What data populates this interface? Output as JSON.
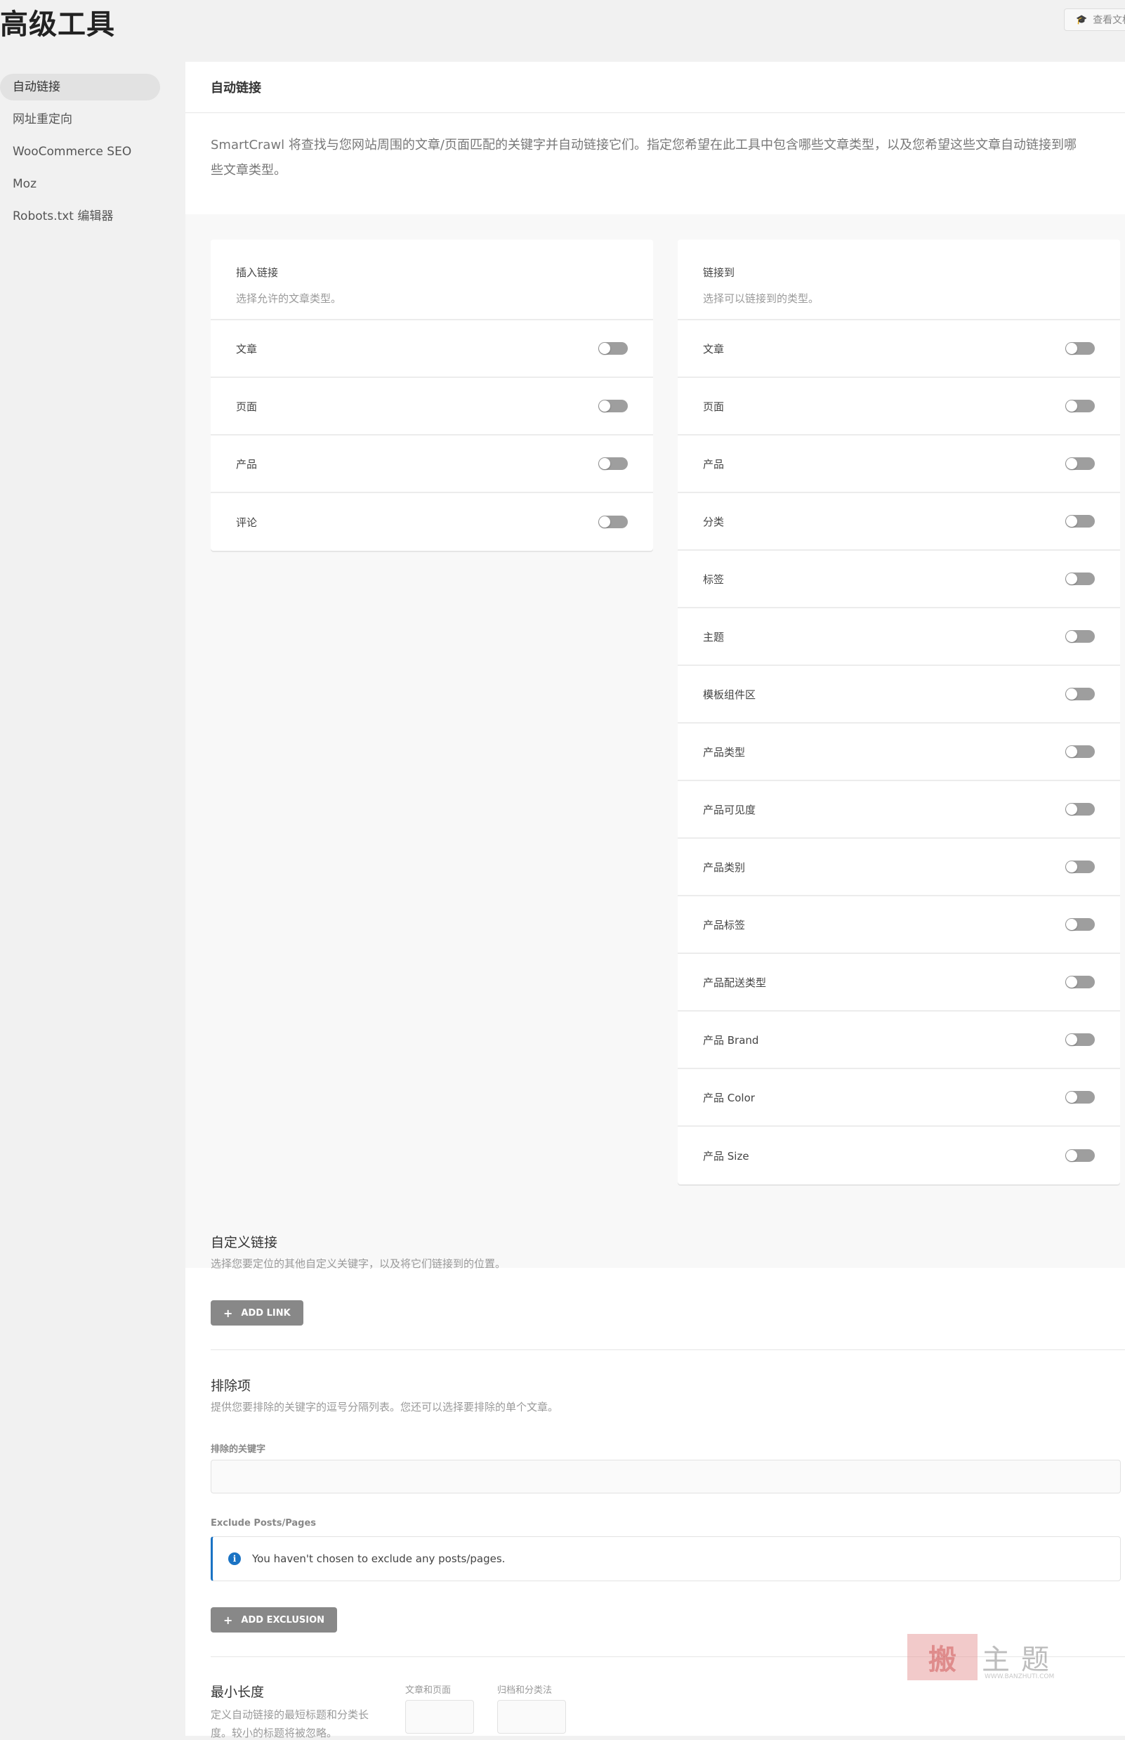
{
  "page": {
    "title": "高级工具",
    "docs_button": "查看文档"
  },
  "sidebar": {
    "items": [
      {
        "label": "自动链接",
        "active": true
      },
      {
        "label": "网址重定向"
      },
      {
        "label": "WooCommerce SEO"
      },
      {
        "label": "Moz"
      },
      {
        "label": "Robots.txt 编辑器"
      }
    ]
  },
  "panel": {
    "title": "自动链接",
    "description": "SmartCrawl 将查找与您网站周围的文章/页面匹配的关键字并自动链接它们。指定您希望在此工具中包含哪些文章类型，以及您希望这些文章自动链接到哪些文章类型。"
  },
  "insert_links": {
    "title": "插入链接",
    "subtitle": "选择允许的文章类型。",
    "items": [
      "文章",
      "页面",
      "产品",
      "评论"
    ]
  },
  "link_to": {
    "title": "链接到",
    "subtitle": "选择可以链接到的类型。",
    "items": [
      "文章",
      "页面",
      "产品",
      "分类",
      "标签",
      "主题",
      "模板组件区",
      "产品类型",
      "产品可见度",
      "产品类别",
      "产品标签",
      "产品配送类型",
      "产品 Brand",
      "产品 Color",
      "产品 Size"
    ]
  },
  "custom_links": {
    "title": "自定义链接",
    "description": "选择您要定位的其他自定义关键字，以及将它们链接到的位置。",
    "button": "ADD LINK"
  },
  "exclusions": {
    "title": "排除项",
    "description": "提供您要排除的关键字的逗号分隔列表。您还可以选择要排除的单个文章。",
    "keywords_label": "排除的关键字",
    "keywords_value": "",
    "posts_label": "Exclude Posts/Pages",
    "notice": "You haven't chosen to exclude any posts/pages.",
    "button": "ADD EXCLUSION"
  },
  "min_length": {
    "title": "最小长度",
    "description_line1": "定义自动链接的最短标题和分类长",
    "description_line2": "度。较小的标题将被忽略。",
    "posts_label": "文章和页面",
    "archives_label": "归档和分类法"
  },
  "watermark": {
    "seal": "搬",
    "text": "主题",
    "url": "WWW.BANZHUTI.COM"
  }
}
